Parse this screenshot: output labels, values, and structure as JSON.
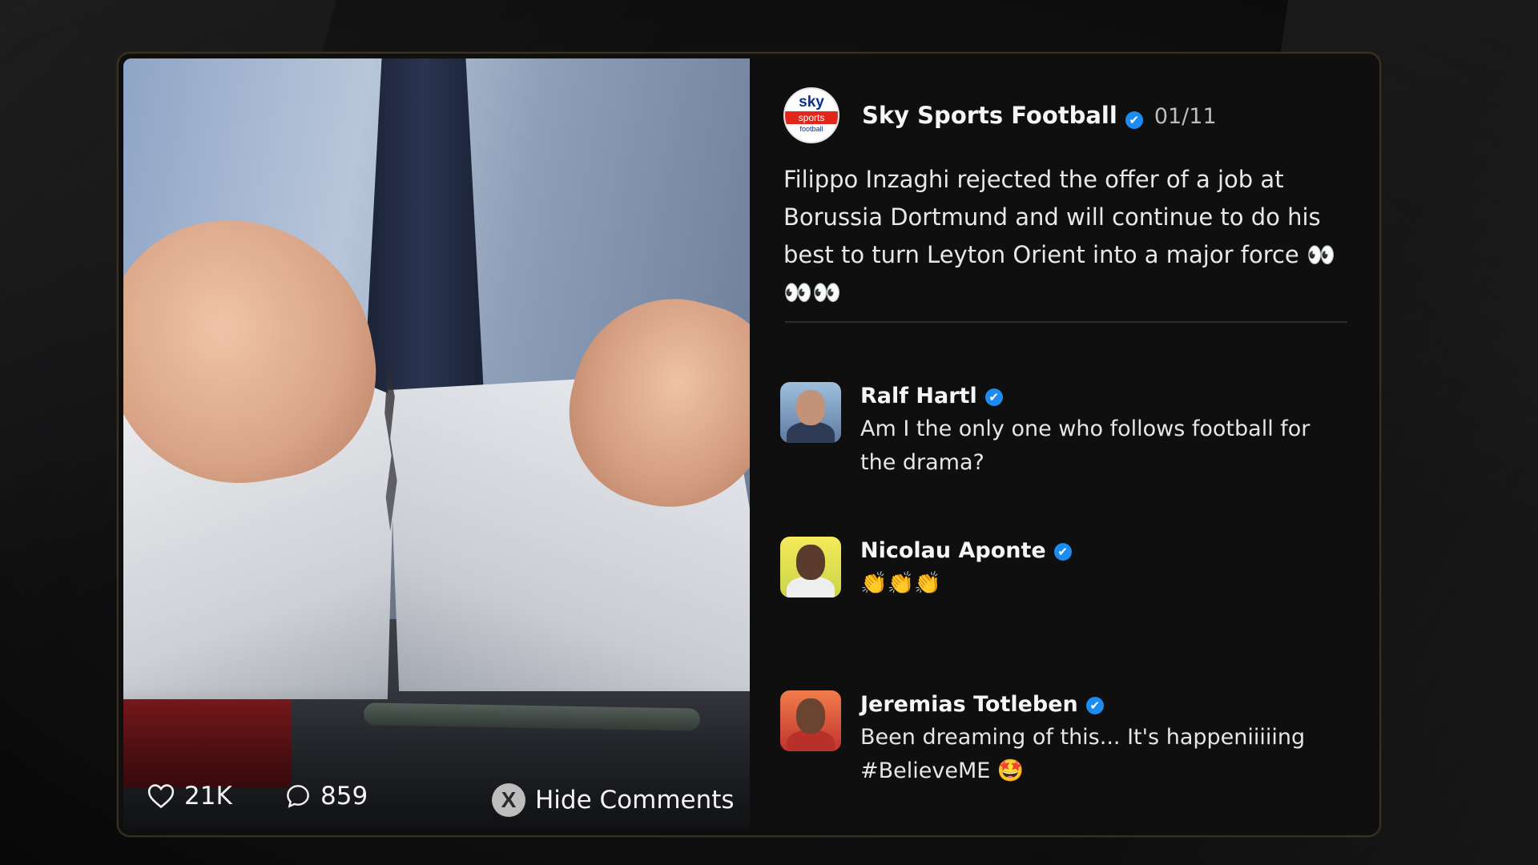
{
  "post": {
    "author": "Sky Sports Football",
    "date": "01/11",
    "text": "Filippo Inzaghi rejected the offer of a job at Borussia Dortmund and will continue to do his best to turn Leyton Orient into a major force 👀👀👀",
    "logo": {
      "line1": "sky",
      "line2": "sports",
      "line3": "football"
    }
  },
  "stats": {
    "likes": "21K",
    "comments": "859",
    "hide_comments_label": "Hide Comments",
    "like_icon": "heart-icon",
    "comment_icon": "speech-bubble-icon",
    "hide_icon": "close-icon"
  },
  "comments": [
    {
      "name": "Ralf Hartl",
      "text": "Am I the only one who follows football for the drama?"
    },
    {
      "name": "Nicolau Aponte",
      "text": "👏👏👏"
    },
    {
      "name": "Jeremias Totleben",
      "text": "Been dreaming of this... It's happeniiiiing #BelieveME 🤩"
    }
  ],
  "colors": {
    "verified": "#1d8cf0",
    "card_border": "#3a3020",
    "panel_bg": "#0f0f10"
  }
}
